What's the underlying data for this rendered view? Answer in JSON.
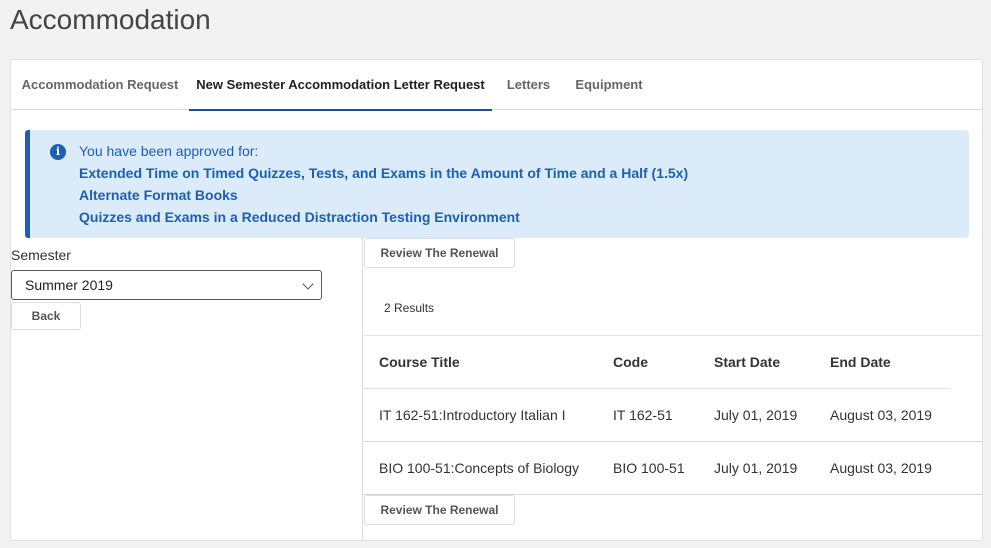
{
  "page": {
    "title": "Accommodation"
  },
  "tabs": [
    {
      "label": "Accommodation Request",
      "active": false
    },
    {
      "label": "New Semester Accommodation Letter Request",
      "active": true
    },
    {
      "label": "Letters",
      "active": false
    },
    {
      "label": "Equipment",
      "active": false
    }
  ],
  "alert": {
    "icon": "info-icon",
    "heading": "You have been approved for:",
    "items": [
      "Extended Time on Timed Quizzes, Tests, and Exams in the Amount of Time and a Half (1.5x)",
      "Alternate Format Books",
      "Quizzes and Exams in a Reduced Distraction Testing Environment"
    ]
  },
  "form": {
    "semester_label": "Semester",
    "semester_value": "Summer 2019",
    "back_label": "Back"
  },
  "actions": {
    "review_label": "Review The Renewal"
  },
  "results": {
    "count_label": "2 Results",
    "columns": [
      "Course Title",
      "Code",
      "Start Date",
      "End Date"
    ],
    "rows": [
      {
        "title": "IT 162-51:Introductory Italian I",
        "code": "IT 162-51",
        "start": "July 01, 2019",
        "end": "August 03, 2019"
      },
      {
        "title": "BIO 100-51:Concepts of Biology",
        "code": "BIO 100-51",
        "start": "July 01, 2019",
        "end": "August 03, 2019"
      }
    ]
  },
  "colors": {
    "accent": "#1d5fb0",
    "alert_bg": "#dcebfa",
    "active_tab": "#1d4f91"
  }
}
